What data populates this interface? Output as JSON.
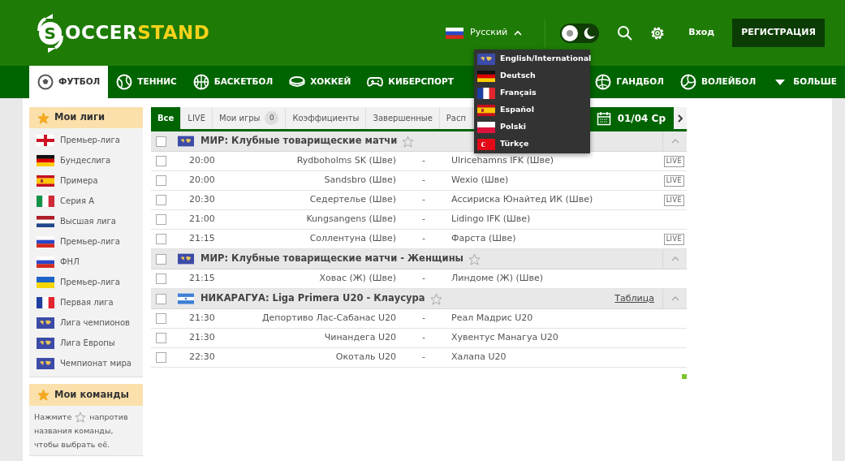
{
  "header": {
    "logo": {
      "first": "S",
      "white": "OCCER",
      "accent": "STAND"
    },
    "language": "Русский",
    "dark_theme": false,
    "login": "Вход",
    "register": "РЕГИСТРАЦИЯ"
  },
  "sports": [
    {
      "label": "ФУТБОЛ",
      "kind": "ball",
      "selected": true
    },
    {
      "label": "ТЕННИС",
      "kind": "tennis",
      "selected": false
    },
    {
      "label": "БАСКЕТБОЛ",
      "kind": "basket",
      "selected": false
    },
    {
      "label": "ХОККЕЙ",
      "kind": "puck",
      "selected": false
    },
    {
      "label": "КИБЕРСПОРТ",
      "kind": "pad",
      "selected": false
    },
    {
      "label": "ГАНДБОЛ",
      "kind": "hand",
      "selected": false
    },
    {
      "label": "ВОЛЕЙБОЛ",
      "kind": "volley",
      "selected": false
    },
    {
      "label": "БОЛЬШЕ",
      "kind": "more",
      "selected": false
    }
  ],
  "language_menu": [
    {
      "label": "English/International",
      "kind": "world"
    },
    {
      "label": "Deutsch",
      "kind": "de"
    },
    {
      "label": "Français",
      "kind": "fr"
    },
    {
      "label": "Español",
      "kind": "es"
    },
    {
      "label": "Polski",
      "kind": "pl"
    },
    {
      "label": "Türkçe",
      "kind": "tr"
    }
  ],
  "sidebar": {
    "leagues_title": "Мои лиги",
    "leagues": [
      {
        "label": "Премьер-лига",
        "kind": "eng"
      },
      {
        "label": "Бундеслига",
        "kind": "de"
      },
      {
        "label": "Примера",
        "kind": "es"
      },
      {
        "label": "Серия А",
        "kind": "it"
      },
      {
        "label": "Высшая лига",
        "kind": "nl"
      },
      {
        "label": "Премьер-лига",
        "kind": "ru"
      },
      {
        "label": "ФНЛ",
        "kind": "ru"
      },
      {
        "label": "Премьер-лига",
        "kind": "ua"
      },
      {
        "label": "Первая лига",
        "kind": "fr"
      },
      {
        "label": "Лига чемпионов",
        "kind": "world"
      },
      {
        "label": "Лига Европы",
        "kind": "world"
      },
      {
        "label": "Чемпионат мира",
        "kind": "world"
      }
    ],
    "teams_title": "Мои команды",
    "teams_hint_before": "Нажмите",
    "teams_hint_after": "напротив",
    "teams_hint_rest": "названия команды, чтобы выбрать её."
  },
  "tabs": [
    {
      "label": "Все",
      "selected": true
    },
    {
      "label": "LIVE",
      "selected": false
    },
    {
      "label": "Мои игры",
      "count": "0",
      "selected": false
    },
    {
      "label": "Коэффициенты",
      "selected": false
    },
    {
      "label": "Завершенные",
      "selected": false
    },
    {
      "label": "Расп",
      "selected": false
    }
  ],
  "date": "01/04 Ср",
  "groups": [
    {
      "title": "МИР: Клубные товарищеские матчи",
      "kind": "world",
      "checked": false,
      "matches": [
        {
          "time": "20:00",
          "home": "Rydboholms SK (Шве)",
          "sep": "-",
          "away": "Ulricehamns IFK (Шве)",
          "badge": "LIVE",
          "checked": false
        },
        {
          "time": "20:00",
          "home": "Sandsbro (Шве)",
          "sep": "-",
          "away": "Wexio (Шве)",
          "badge": "LIVE",
          "checked": false
        },
        {
          "time": "20:30",
          "home": "Седертелье (Шве)",
          "sep": "-",
          "away": "Ассириска Юнайтед ИК (Шве)",
          "badge": "LIVE",
          "checked": false
        },
        {
          "time": "21:00",
          "home": "Kungsangens (Шве)",
          "sep": "-",
          "away": "Lidingo IFK (Шве)",
          "checked": false
        },
        {
          "time": "21:15",
          "home": "Соллентуна (Шве)",
          "sep": "-",
          "away": "Фарста (Шве)",
          "badge": "LIVE",
          "checked": false
        }
      ]
    },
    {
      "title": "МИР: Клубные товарищеские матчи - Женщины",
      "kind": "world",
      "checked": false,
      "matches": [
        {
          "time": "21:15",
          "home": "Ховас (Ж) (Шве)",
          "sep": "-",
          "away": "Линдоме (Ж) (Шве)",
          "checked": false
        }
      ]
    },
    {
      "title": "НИКАРАГУА: Liga Primera U20 - Клаусура",
      "kind": "ni",
      "link": "Таблица",
      "checked": false,
      "matches": [
        {
          "time": "21:30",
          "home": "Депортиво Лас-Сабанас U20",
          "sep": "-",
          "away": "Реал Мадрис U20",
          "checked": false
        },
        {
          "time": "21:30",
          "home": "Чинандега U20",
          "sep": "-",
          "away": "Хувентус Манагуа U20",
          "checked": false
        },
        {
          "time": "22:30",
          "home": "Окоталь U20",
          "sep": "-",
          "away": "Халапа U20",
          "checked": false
        }
      ]
    }
  ]
}
